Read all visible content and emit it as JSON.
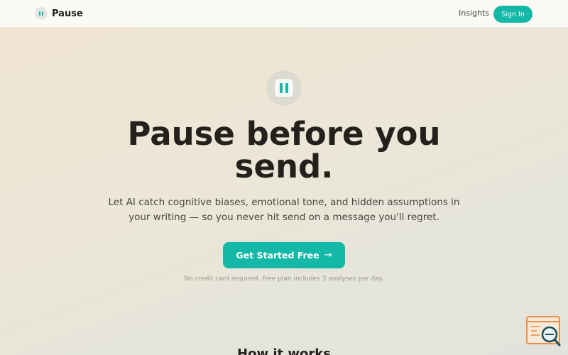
{
  "header": {
    "brand_name": "Pause",
    "nav_insights": "Insights",
    "signin_label": "Sign In"
  },
  "hero": {
    "title_line1": "Pause before you",
    "title_line2": "send.",
    "subtitle": "Let AI catch cognitive biases, emotional tone, and hidden assumptions in your writing — so you never hit send on a message you'll regret.",
    "cta_label": "Get Started Free",
    "cta_icon": "arrow-right-icon",
    "note": "No credit card required. Free plan includes 3 analyses per day."
  },
  "sections": {
    "how_it_works_title": "How it works"
  },
  "widget": {
    "icon": "browser-search-icon"
  },
  "colors": {
    "accent": "#14b8a6",
    "text_dark": "#24211d",
    "widget_orange": "#e8914a"
  }
}
